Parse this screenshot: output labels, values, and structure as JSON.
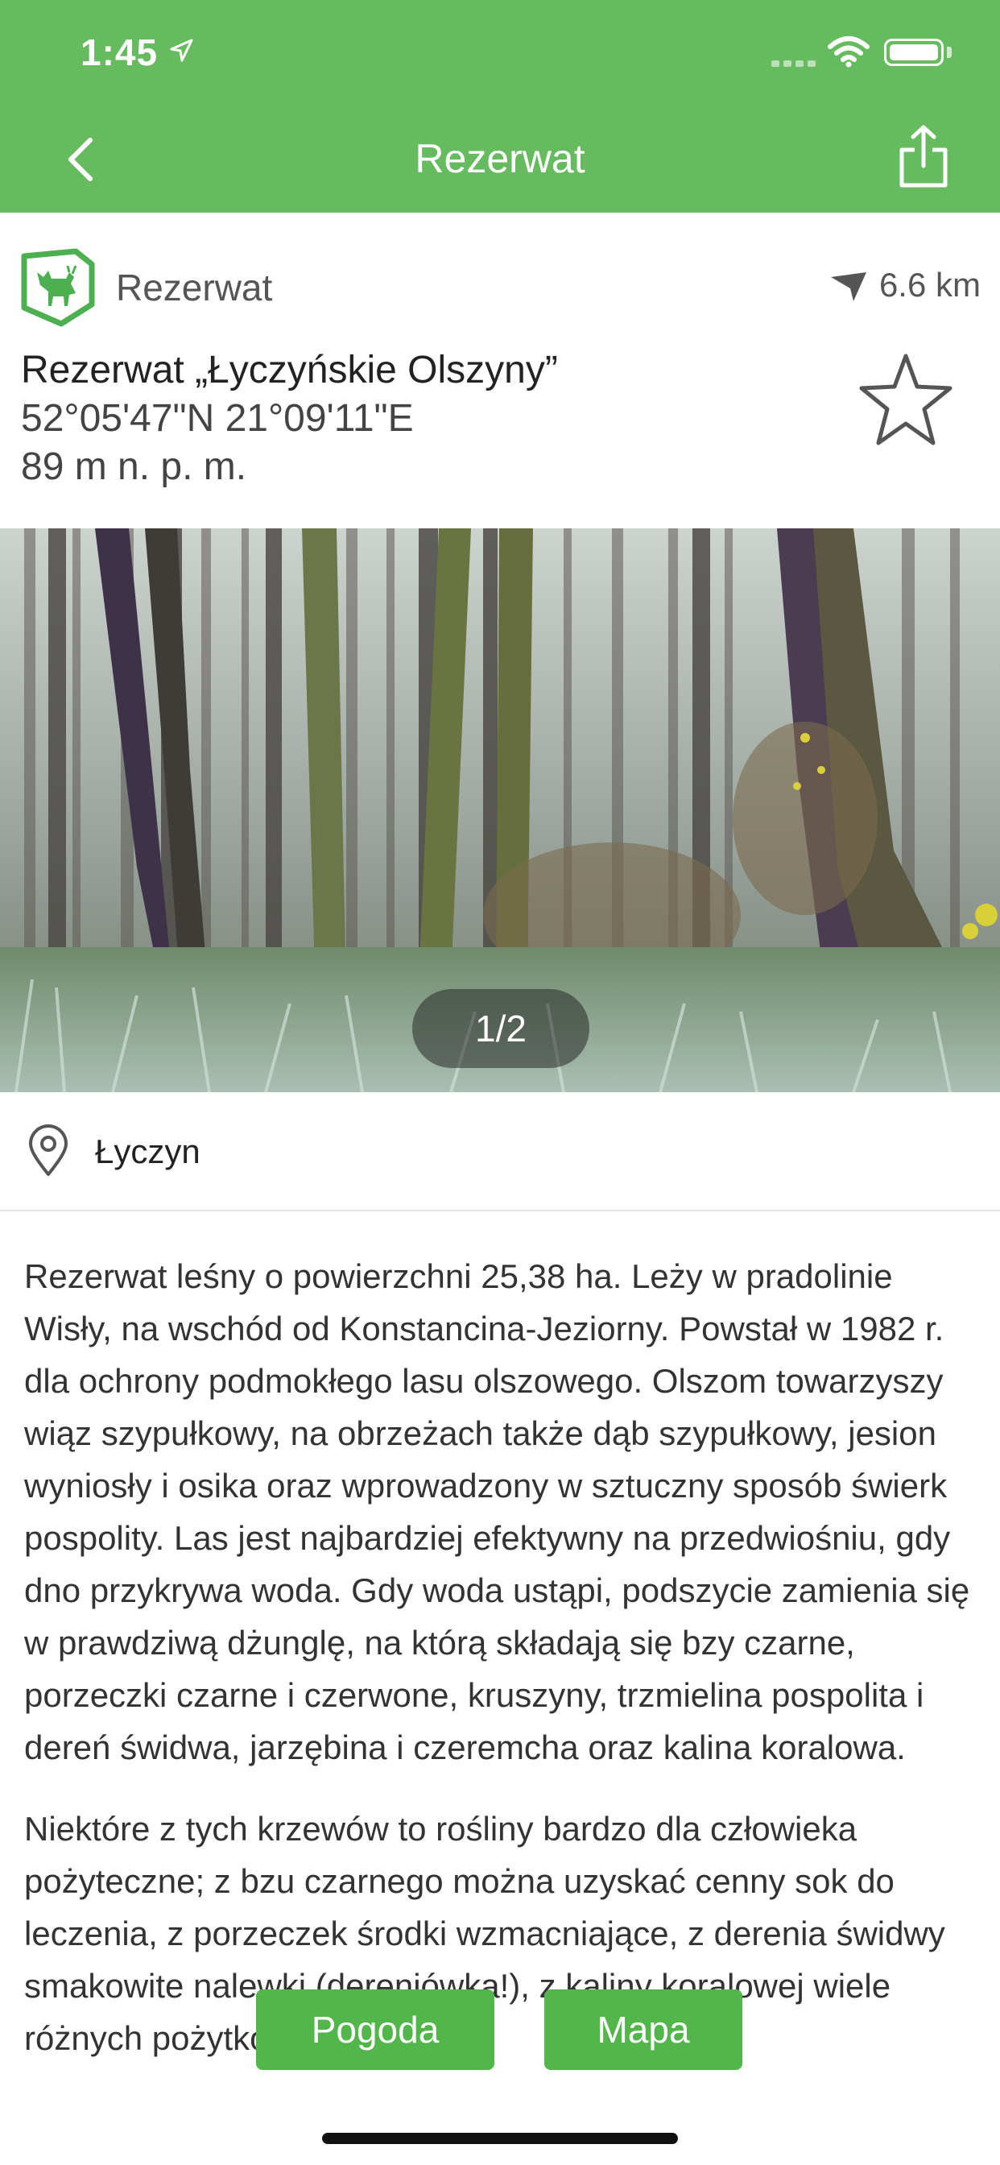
{
  "status_bar": {
    "time": "1:45"
  },
  "nav": {
    "title": "Rezerwat",
    "back_icon": "chevron-left-icon",
    "share_icon": "share-icon"
  },
  "place": {
    "category": "Rezerwat",
    "distance": "6.6 km",
    "name": "Rezerwat „Łyczyńskie Olszyny”",
    "coordinates": "52°05'47\"N 21°09'11\"E",
    "elevation": "89 m n. p. m."
  },
  "gallery": {
    "counter": "1/2"
  },
  "location": {
    "name": "Łyczyn"
  },
  "description": {
    "paragraphs": [
      "Rezerwat leśny o powierzchni 25,38 ha. Leży w pradolinie Wisły, na wschód od Konstancina-Jeziorny. Powstał w 1982 r. dla ochrony podmokłego lasu olszowego. Olszom towarzyszy wiąz szypułkowy, na obrzeżach także dąb szypułkowy, jesion wyniosły i osika oraz wprowadzony w sztuczny sposób świerk pospolity. Las jest najbardziej efektywny na przedwiośniu, gdy dno przykrywa woda. Gdy woda ustąpi, podszycie zamienia się w prawdziwą dżunglę, na którą składają się bzy czarne, porzeczki czarne i czerwone, kruszyny, trzmielina pospolita i dereń świdwa, jarzębina i czeremcha oraz kalina koralowa.",
      "Niektóre z tych krzewów to rośliny bardzo dla człowieka pożyteczne; z bzu czarnego można uzyskać cenny sok do leczenia, z porzeczek środki wzmacniające, z derenia świdwy smakowite nalewki (dereniówka!), z kaliny koralowej wiele różnych pożytków leczniczych."
    ]
  },
  "actions": {
    "weather": "Pogoda",
    "map": "Mapa"
  },
  "colors": {
    "header": "#66bb5f",
    "button": "#52b64a",
    "icon_green": "#4caf50"
  }
}
